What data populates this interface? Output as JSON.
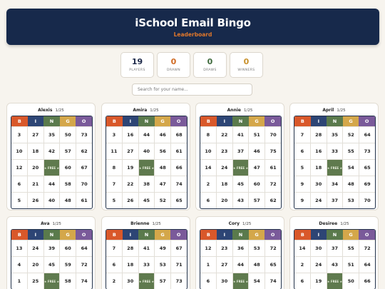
{
  "header": {
    "title": "iSchool Email Bingo",
    "subtitle": "Leaderboard"
  },
  "stats": [
    {
      "value": "19",
      "label": "PLAYERS",
      "color": "#1e2a4a"
    },
    {
      "value": "0",
      "label": "DRAWN",
      "color": "#d06a22"
    },
    {
      "value": "0",
      "label": "DRAWS",
      "color": "#3e6a3c"
    },
    {
      "value": "0",
      "label": "WINNERS",
      "color": "#c8902a"
    }
  ],
  "search": {
    "placeholder": "Search for your name..."
  },
  "letters": [
    "B",
    "I",
    "N",
    "G",
    "O"
  ],
  "letter_colors": [
    "#d9582a",
    "#2d4575",
    "#5a7a4c",
    "#d4a74a",
    "#7a5a9a"
  ],
  "free_label": "★ FREE ★",
  "cards": [
    {
      "name": "Alexis",
      "count": "1/25",
      "rows": [
        [
          "3",
          "27",
          "35",
          "50",
          "73"
        ],
        [
          "10",
          "18",
          "42",
          "57",
          "62"
        ],
        [
          "12",
          "20",
          "FREE",
          "60",
          "67"
        ],
        [
          "6",
          "21",
          "44",
          "58",
          "70"
        ],
        [
          "5",
          "26",
          "40",
          "48",
          "61"
        ]
      ]
    },
    {
      "name": "Amira",
      "count": "1/25",
      "rows": [
        [
          "3",
          "16",
          "44",
          "46",
          "68"
        ],
        [
          "11",
          "27",
          "40",
          "56",
          "61"
        ],
        [
          "8",
          "19",
          "FREE",
          "48",
          "66"
        ],
        [
          "7",
          "22",
          "38",
          "47",
          "74"
        ],
        [
          "5",
          "26",
          "45",
          "52",
          "65"
        ]
      ]
    },
    {
      "name": "Annie",
      "count": "1/25",
      "rows": [
        [
          "8",
          "22",
          "41",
          "51",
          "70"
        ],
        [
          "10",
          "23",
          "37",
          "46",
          "75"
        ],
        [
          "14",
          "24",
          "FREE",
          "47",
          "61"
        ],
        [
          "2",
          "18",
          "45",
          "60",
          "72"
        ],
        [
          "6",
          "20",
          "43",
          "57",
          "62"
        ]
      ]
    },
    {
      "name": "April",
      "count": "1/25",
      "rows": [
        [
          "7",
          "28",
          "35",
          "52",
          "64"
        ],
        [
          "6",
          "16",
          "33",
          "55",
          "73"
        ],
        [
          "5",
          "18",
          "FREE",
          "54",
          "65"
        ],
        [
          "9",
          "30",
          "34",
          "48",
          "69"
        ],
        [
          "9",
          "24",
          "37",
          "53",
          "70"
        ]
      ]
    },
    {
      "name": "Ava",
      "count": "1/25",
      "rows": [
        [
          "13",
          "24",
          "39",
          "60",
          "64"
        ],
        [
          "4",
          "20",
          "45",
          "59",
          "72"
        ],
        [
          "1",
          "25",
          "FREE",
          "58",
          "74"
        ],
        [
          "",
          "",
          "",
          "",
          ""
        ],
        [
          "",
          "",
          "",
          "",
          ""
        ]
      ]
    },
    {
      "name": "Brienne",
      "count": "1/25",
      "rows": [
        [
          "7",
          "28",
          "41",
          "49",
          "67"
        ],
        [
          "6",
          "18",
          "33",
          "53",
          "71"
        ],
        [
          "2",
          "30",
          "FREE",
          "57",
          "73"
        ],
        [
          "",
          "",
          "",
          "",
          ""
        ],
        [
          "",
          "",
          "",
          "",
          ""
        ]
      ]
    },
    {
      "name": "Cory",
      "count": "1/25",
      "rows": [
        [
          "12",
          "23",
          "36",
          "53",
          "72"
        ],
        [
          "1",
          "27",
          "44",
          "48",
          "65"
        ],
        [
          "6",
          "30",
          "FREE",
          "54",
          "74"
        ],
        [
          "",
          "",
          "",
          "",
          ""
        ],
        [
          "",
          "",
          "",
          "",
          ""
        ]
      ]
    },
    {
      "name": "Desiree",
      "count": "1/25",
      "rows": [
        [
          "14",
          "30",
          "37",
          "55",
          "72"
        ],
        [
          "2",
          "24",
          "43",
          "51",
          "64"
        ],
        [
          "6",
          "19",
          "FREE",
          "50",
          "66"
        ],
        [
          "",
          "",
          "",
          "",
          ""
        ],
        [
          "",
          "",
          "",
          "",
          ""
        ]
      ]
    }
  ]
}
